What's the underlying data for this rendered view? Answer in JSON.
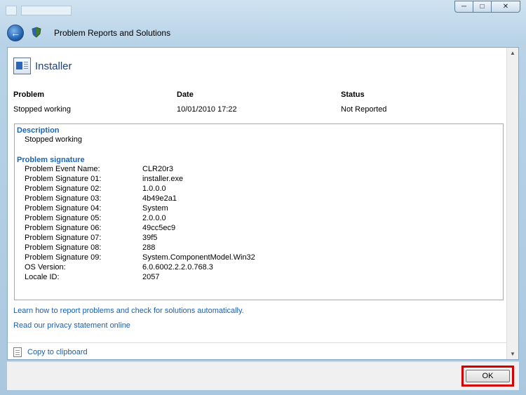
{
  "window": {
    "title": "Problem Reports and Solutions"
  },
  "report": {
    "heading": "Installer",
    "columns": [
      {
        "label": "Problem",
        "value": "Stopped working"
      },
      {
        "label": "Date",
        "value": "10/01/2010 17:22"
      },
      {
        "label": "Status",
        "value": "Not Reported"
      }
    ]
  },
  "details": {
    "description_title": "Description",
    "description_text": "Stopped working",
    "signature_title": "Problem signature",
    "signature": [
      {
        "key": "Problem Event Name:",
        "value": "CLR20r3"
      },
      {
        "key": "Problem Signature 01:",
        "value": "installer.exe"
      },
      {
        "key": "Problem Signature 02:",
        "value": "1.0.0.0"
      },
      {
        "key": "Problem Signature 03:",
        "value": "4b49e2a1"
      },
      {
        "key": "Problem Signature 04:",
        "value": "System"
      },
      {
        "key": "Problem Signature 05:",
        "value": "2.0.0.0"
      },
      {
        "key": "Problem Signature 06:",
        "value": "49cc5ec9"
      },
      {
        "key": "Problem Signature 07:",
        "value": "39f5"
      },
      {
        "key": "Problem Signature 08:",
        "value": "288"
      },
      {
        "key": "Problem Signature 09:",
        "value": "System.ComponentModel.Win32"
      },
      {
        "key": "OS Version:",
        "value": "6.0.6002.2.2.0.768.3"
      },
      {
        "key": "Locale ID:",
        "value": "2057"
      }
    ]
  },
  "links": {
    "learn": "Learn how to report problems and check for solutions automatically.",
    "privacy": "Read our privacy statement online",
    "copy": "Copy to clipboard"
  },
  "footer": {
    "ok_label": "OK"
  },
  "icons": {
    "back": "back-arrow-icon",
    "app": "shield-icon",
    "report": "document-icon",
    "clipboard": "clipboard-icon"
  },
  "colors": {
    "link": "#1a5fb4",
    "heading": "#1e3f7a",
    "highlight": "#d40000"
  }
}
